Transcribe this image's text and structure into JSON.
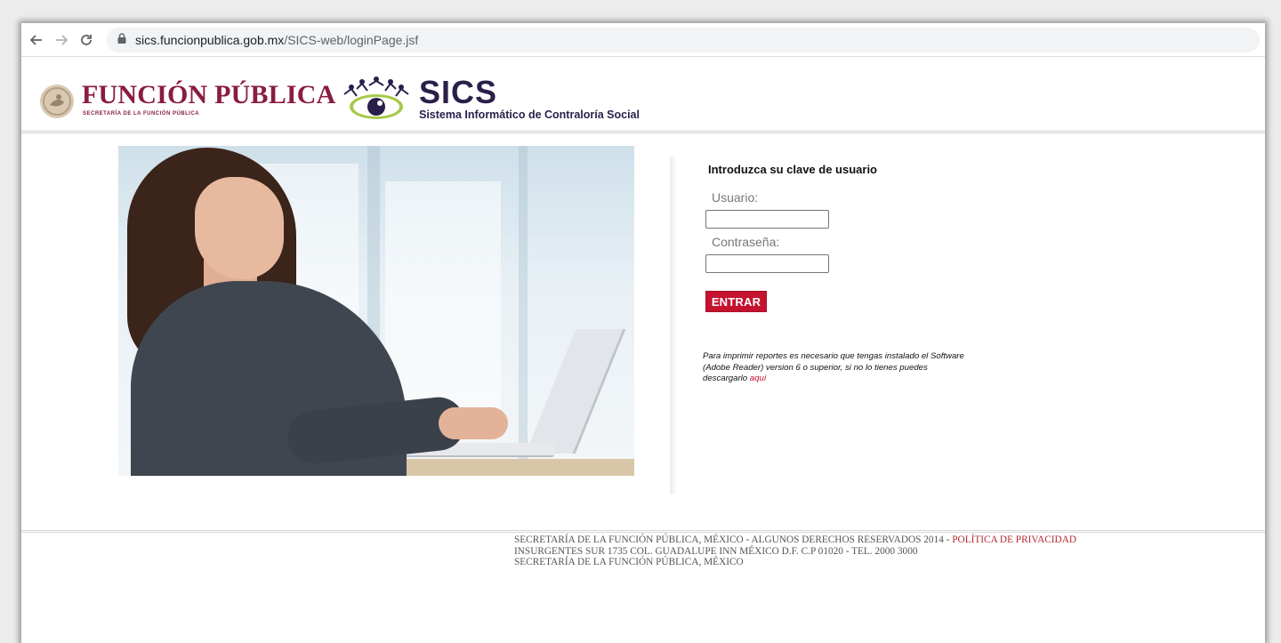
{
  "browser": {
    "url_domain": "sics.funcionpublica.gob.mx",
    "url_path": "/SICS-web/loginPage.jsf"
  },
  "header": {
    "org_name": "FUNCIÓN PÚBLICA",
    "org_subtitle": "SECRETARÍA DE LA FUNCIÓN PÚBLICA",
    "system_name": "SICS",
    "system_full_name": "Sistema Informático de Contraloría Social",
    "brand_color": "#8a1c40",
    "system_color": "#2a1f4a"
  },
  "login": {
    "title": "Introduzca su clave de usuario",
    "user_label": "Usuario:",
    "user_value": "",
    "password_label": "Contraseña:",
    "password_value": "",
    "submit_label": "ENTRAR",
    "accent_color": "#c4122f"
  },
  "note": {
    "text": "Para imprimir reportes es necesario que tengas instalado el Software (Adobe Reader) version 6 o superior, si no lo tienes puedes descargarlo ",
    "link_label": "aquí"
  },
  "footer": {
    "line1": "Secretaría de la Función Pública, México - Algunos Derechos Reservados 2014 - ",
    "privacy_link": "Política de Privacidad",
    "line2": "Insurgentes Sur 1735 Col. Guadalupe Inn México D.F. C.P 01020 - Tel. 2000 3000",
    "line3": "Secretaría de la Función Pública, México"
  },
  "icons": [
    "back-arrow-icon",
    "forward-arrow-icon",
    "reload-icon",
    "lock-icon",
    "mexico-seal-icon",
    "sics-eye-logo-icon"
  ]
}
